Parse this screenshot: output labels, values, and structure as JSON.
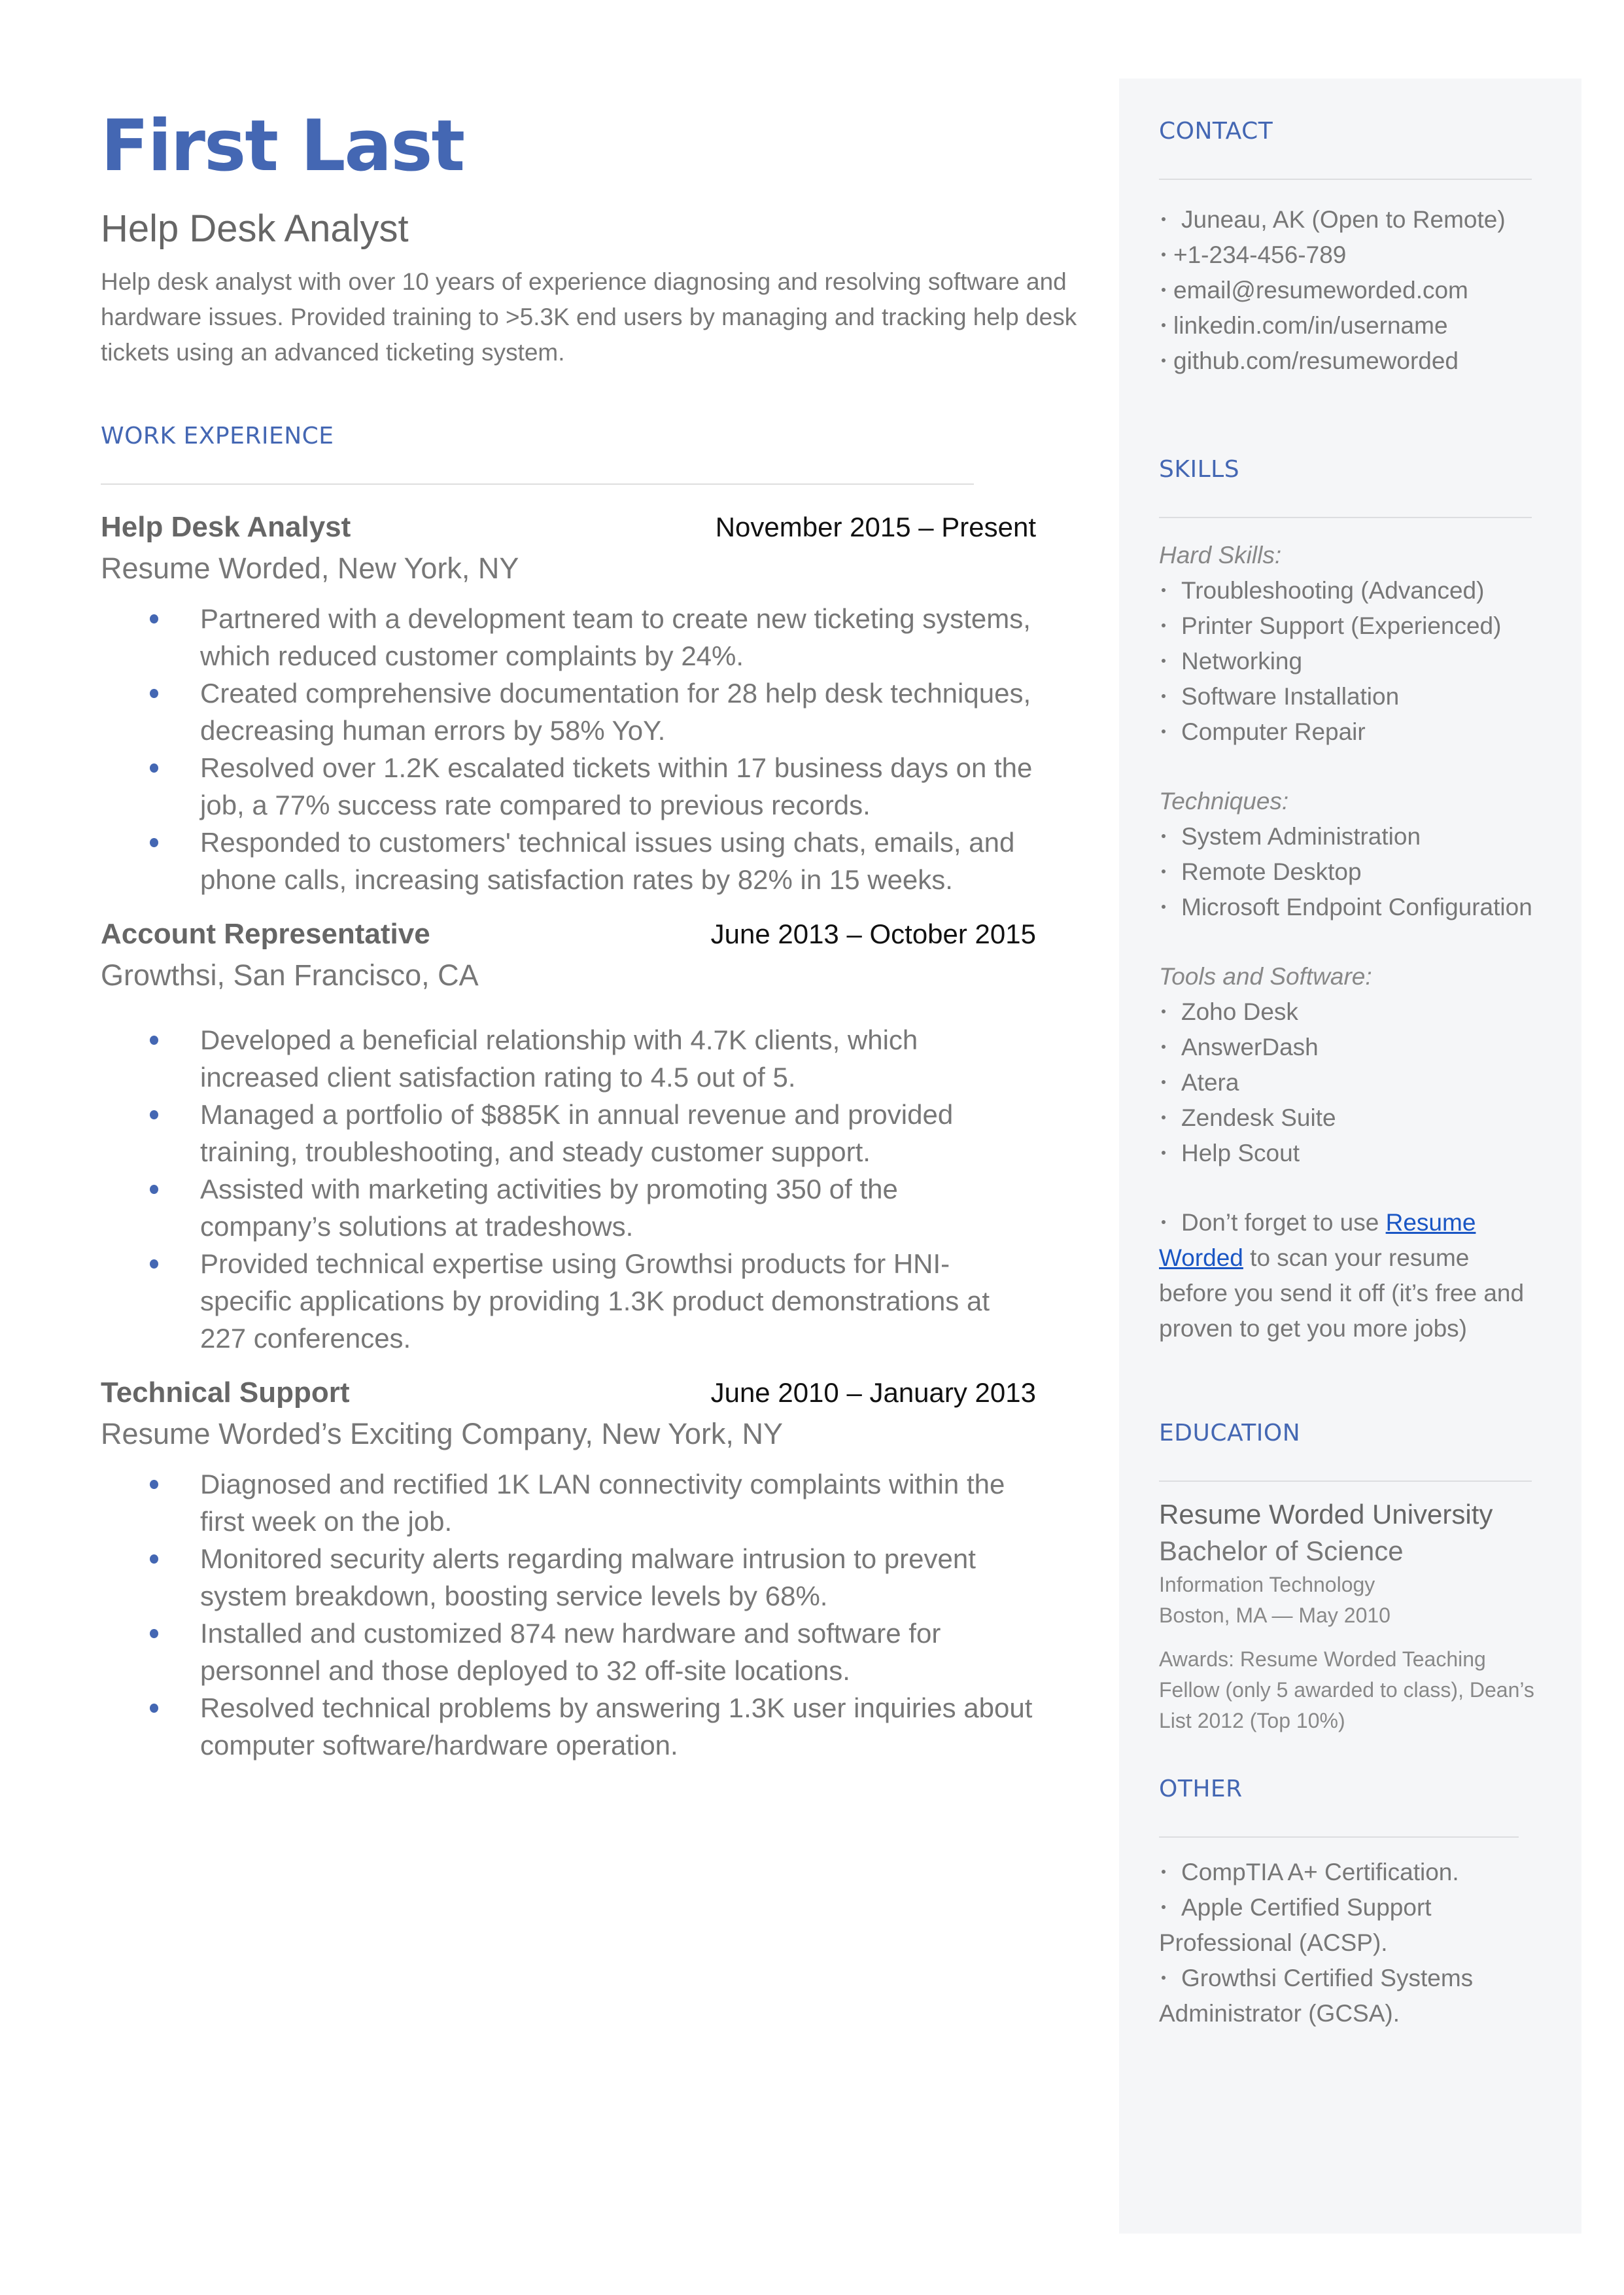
{
  "header": {
    "name": "First Last",
    "role": "Help Desk Analyst",
    "summary": "Help desk analyst with over 10 years of experience diagnosing and resolving software and hardware issues. Provided training to >5.3K end users by managing and tracking help desk tickets using an advanced ticketing system."
  },
  "colors": {
    "accent": "#4467b3",
    "sidebar_bg": "#f5f6f8",
    "link": "#1a56c4"
  },
  "work": {
    "title": "WORK EXPERIENCE",
    "jobs": [
      {
        "title": "Help Desk Analyst",
        "dates": "November 2015 – Present",
        "company": "Resume Worded, New York, NY",
        "bullets": [
          "Partnered with a development team to create new ticketing systems, which reduced customer complaints by 24%.",
          "Created comprehensive documentation for 28 help desk techniques, decreasing human errors by 58% YoY.",
          "Resolved over 1.2K escalated tickets within 17 business days on the job, a 77% success rate compared to previous records.",
          "Responded to customers' technical issues using chats, emails, and phone calls, increasing satisfaction rates by 82% in 15 weeks."
        ]
      },
      {
        "title": "Account Representative",
        "dates": "June 2013 – October 2015",
        "company": "Growthsi, San Francisco, CA",
        "bullets": [
          "Developed a beneficial relationship with 4.7K clients, which increased client satisfaction rating to 4.5 out of 5.",
          "Managed a portfolio of $885K in annual revenue and provided training, troubleshooting, and steady customer support.",
          "Assisted with marketing activities by promoting 350 of the company’s solutions at tradeshows.",
          "Provided technical expertise using Growthsi products for HNI-specific applications by providing 1.3K product demonstrations at 227 conferences."
        ]
      },
      {
        "title": "Technical Support",
        "dates": "June 2010 – January 2013",
        "company": "Resume Worded’s Exciting Company, New York, NY",
        "bullets": [
          "Diagnosed and rectified 1K LAN connectivity complaints within the first week on the job.",
          "Monitored security alerts regarding malware intrusion to prevent system breakdown, boosting service levels by 68%.",
          "Installed and customized 874 new hardware and software for personnel and those deployed to 32 off-site locations.",
          "Resolved technical problems by answering 1.3K user inquiries about computer software/hardware operation."
        ]
      }
    ]
  },
  "sidebar": {
    "contact": {
      "title": "CONTACT",
      "items": [
        "Juneau, AK (Open to Remote)",
        "+1-234-456-789",
        "email@resumeworded.com",
        "linkedin.com/in/username",
        "github.com/resumeworded"
      ]
    },
    "skills": {
      "title": "SKILLS",
      "hard_label": "Hard Skills:",
      "hard": [
        "Troubleshooting (Advanced)",
        "Printer Support (Experienced)",
        "Networking",
        "Software Installation",
        "Computer Repair"
      ],
      "techniques_label": "Techniques:",
      "techniques": [
        "System Administration",
        "Remote Desktop",
        "Microsoft Endpoint Configuration"
      ],
      "tools_label": "Tools and Software:",
      "tools": [
        "Zoho Desk",
        "AnswerDash",
        "Atera",
        "Zendesk Suite",
        "Help Scout"
      ],
      "tip_prefix": "Don’t forget to use ",
      "tip_link": "Resume Worded",
      "tip_suffix": " to scan your resume before you send it off (it’s free and proven to get you more jobs)"
    },
    "education": {
      "title": "EDUCATION",
      "school": "Resume Worded University",
      "degree": "Bachelor of Science",
      "field": "Information Technology",
      "location_date": "Boston, MA — May 2010",
      "awards": "Awards: Resume Worded Teaching Fellow (only 5 awarded to class), Dean’s List 2012 (Top 10%)"
    },
    "other": {
      "title": "OTHER",
      "items": [
        "CompTIA A+ Certification.",
        "Apple Certified Support Professional (ACSP).",
        "Growthsi Certified Systems Administrator (GCSA)."
      ]
    }
  }
}
